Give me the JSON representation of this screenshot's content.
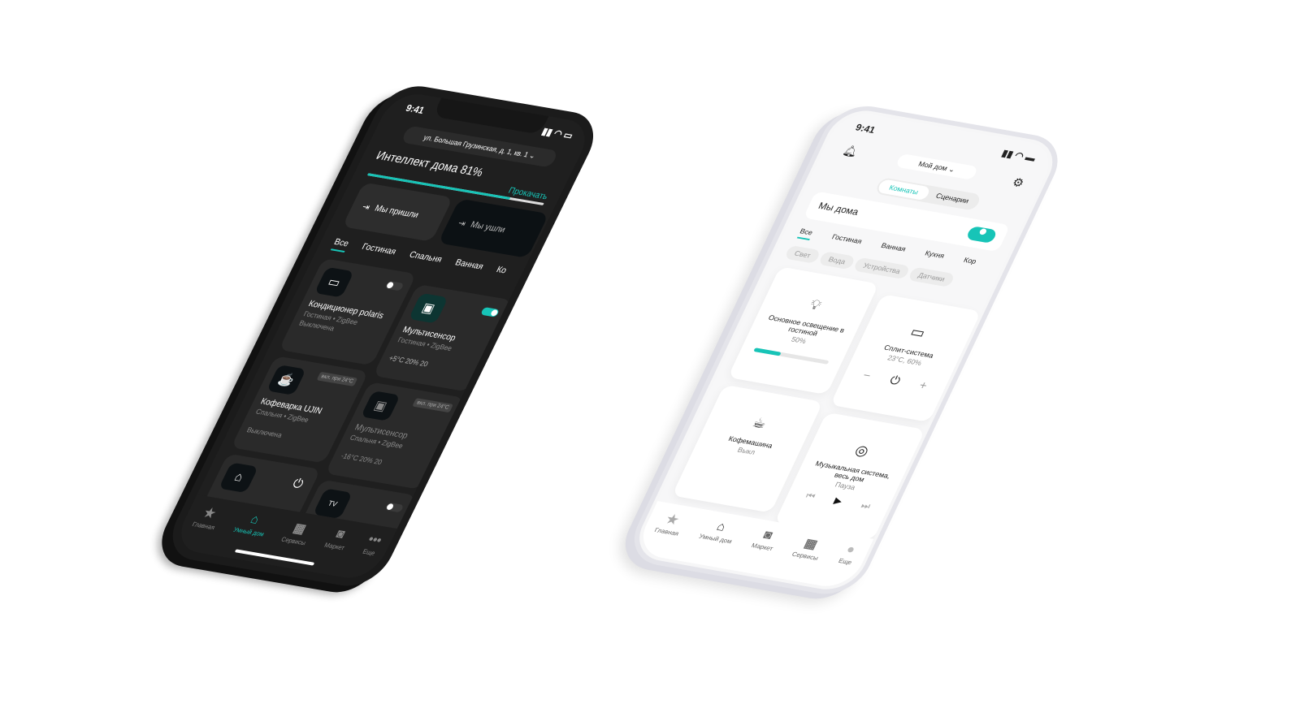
{
  "colors": {
    "accent": "#17c4b7"
  },
  "dark": {
    "status": {
      "time": "9:41"
    },
    "address": "ул. Большая Грузинская, д. 1, кв. 1",
    "intellect": {
      "label": "Интеллект дома 81%",
      "value_pct": 81,
      "action": "Прокачать"
    },
    "scenes": [
      {
        "label": "Мы пришли"
      },
      {
        "label": "Мы ушли"
      }
    ],
    "tabs": [
      "Все",
      "Гостиная",
      "Спальня",
      "Ванная",
      "Ко"
    ],
    "devices": [
      {
        "name": "Кондиционер polaris",
        "meta": "Гостиная • ZigBee",
        "state": "Выключена",
        "on": false
      },
      {
        "name": "Мультисенсор",
        "meta": "Гостиная • ZigBee",
        "readings": "+5°C  20%  20",
        "on": true
      },
      {
        "name": "Кофеварка UJIN",
        "meta": "Спальня • ZigBee",
        "state": "Выключена",
        "badge": "вкл. при 24°C"
      },
      {
        "name": "Мультисенсор",
        "meta": "Спальня • ZigBee",
        "readings": "-16°C  20%  20",
        "badge": "вкл. при 24°C"
      }
    ],
    "nav": [
      "Главная",
      "Умный дом",
      "Сервисы",
      "Маркет",
      "Еще"
    ]
  },
  "light": {
    "status": {
      "time": "9:41"
    },
    "home_select": "Мой дом",
    "segments": [
      "Комнаты",
      "Сценарии"
    ],
    "home_toggle": {
      "label": "Мы дома",
      "on": true
    },
    "tabs": [
      "Все",
      "Гостиная",
      "Ванная",
      "Кухня",
      "Кор"
    ],
    "chips": [
      "Свет",
      "Вода",
      "Устройства",
      "Датчики"
    ],
    "devices": [
      {
        "name": "Основное освещение в гостиной",
        "state": "50%",
        "level_pct": 35
      },
      {
        "name": "Сплит-система",
        "state": "23°C, 60%"
      },
      {
        "name": "Кофемашина",
        "state": "Выкл"
      },
      {
        "name": "Музыкальная система, весь дом",
        "state": "Пауза"
      }
    ],
    "nav": [
      "Главная",
      "Умный дом",
      "Маркет",
      "Сервисы",
      "Еще"
    ]
  }
}
